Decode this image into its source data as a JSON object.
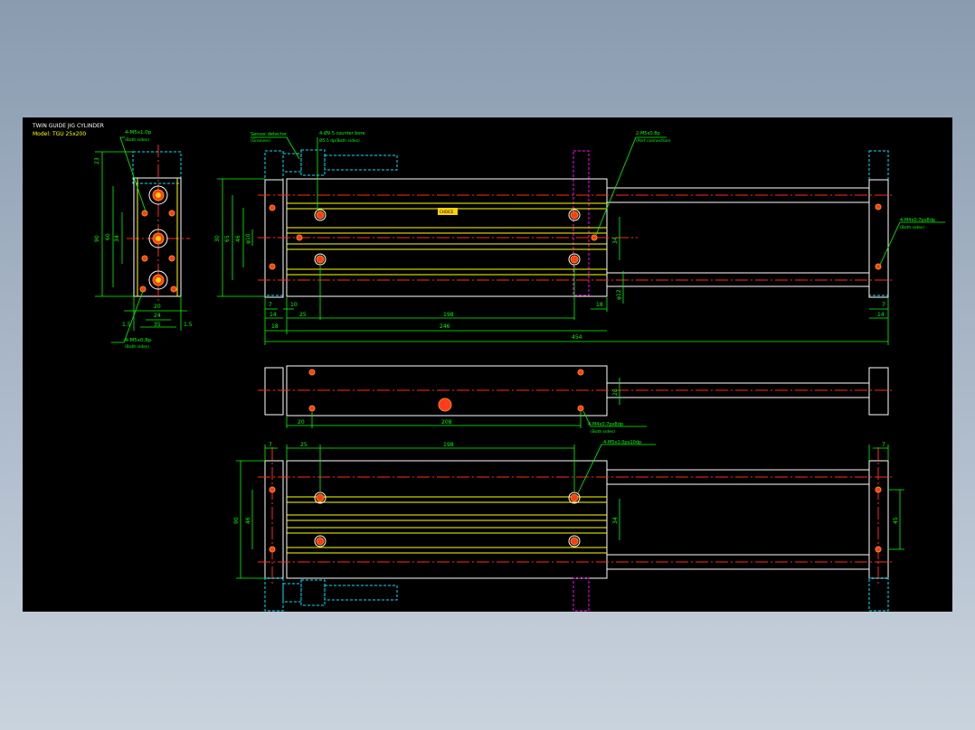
{
  "title_block": {
    "title": "TWIN GUIDE JIG CYLINDER",
    "model": "Model: TGU 25x200"
  },
  "colors": {
    "background": "#000000",
    "outline": "#ffffff",
    "inner_lines": "#ffff00",
    "dimensions": "#00ff00",
    "centerlines": "#ff2a1a",
    "hidden": "#00e5ff",
    "mounting": "#ff00ff"
  },
  "end_view": {
    "note_top": "4-M5x1.0p",
    "note_top_sub": "(Both sides)",
    "note_bottom": "4-M5x0.8p",
    "note_bottom_sub": "(Both sides)",
    "dims": {
      "d23": "23",
      "d90": "90",
      "d34": "34",
      "d60": "60",
      "d20": "20",
      "d24": "24",
      "d35": "35",
      "d15a": "1.5",
      "d15b": "1.5"
    }
  },
  "top_view": {
    "note_sensor": "Sensor detector",
    "note_sensor_sub": "(Grooves)",
    "note_counterbore": "4-Ø9.5 counter bore",
    "note_counterbore_sub": "Ø5.5 dp(Both sides)",
    "note_port": "2-M5x0.8p",
    "note_port_sub": "(Port connection)",
    "note_right": "4-M4x0.7px8dp",
    "note_right_sub": "(Both sides)",
    "label_tag": "CHOICE",
    "dims": {
      "d30": "30",
      "d65": "65",
      "d46": "46",
      "d_phi10": "φ10",
      "d7a": "7",
      "d14a": "14",
      "d10": "10",
      "d25": "25",
      "d198": "198",
      "d18r": "18",
      "d34": "34",
      "d_phi12": "φ12",
      "d7b": "7",
      "d14b": "14",
      "d18": "18",
      "d246": "246",
      "d454": "454"
    }
  },
  "side_view": {
    "note": "4-M4x0.7px8dp",
    "note_sub": "(Both sides)",
    "dims": {
      "d20": "20",
      "d208": "208",
      "d28": "28"
    }
  },
  "bottom_view": {
    "note": "4-M5x1.0px10dp",
    "dims": {
      "d7a": "7",
      "d25": "25",
      "d198": "198",
      "d7b": "7",
      "d90": "90",
      "d46": "46",
      "d34": "34",
      "d45": "45"
    }
  }
}
